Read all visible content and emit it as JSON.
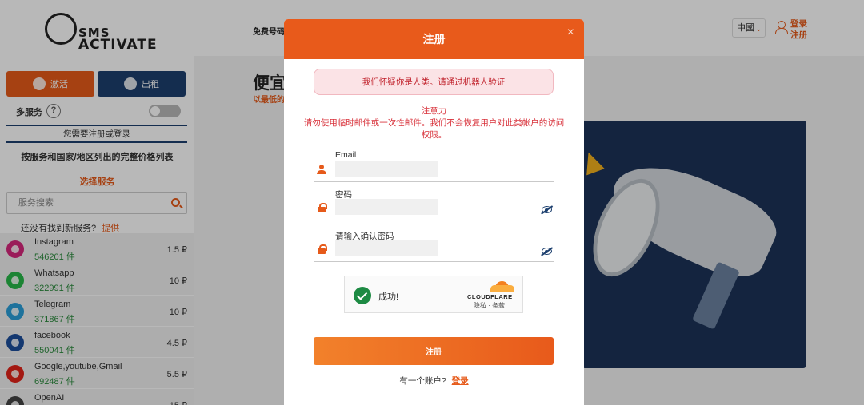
{
  "logo": {
    "line1": "SMS",
    "line2": "ACTIVATE"
  },
  "sidebar": {
    "activate_label": "激活",
    "rent_label": "出租",
    "multi_service_label": "多服务",
    "help_label": "?",
    "need_login_text": "您需要注册或登录",
    "price_list_link": "按服务和国家/地区列出的完整价格列表",
    "select_service_label": "选择服务",
    "search_placeholder": "服务搜索",
    "not_found_text": "还没有找到新服务?",
    "offer_link": "提供",
    "services": [
      {
        "name": "Instagram",
        "count": "546201 件",
        "price": "1.5 ₽",
        "icon": "instagram-icon",
        "color": "#d6287c"
      },
      {
        "name": "Whatsapp",
        "count": "322991 件",
        "price": "10 ₽",
        "icon": "whatsapp-icon",
        "color": "#27b848"
      },
      {
        "name": "Telegram",
        "count": "371867 件",
        "price": "10 ₽",
        "icon": "telegram-icon",
        "color": "#2a9ed8"
      },
      {
        "name": "facebook",
        "count": "550041 件",
        "price": "4.5 ₽",
        "icon": "facebook-icon",
        "color": "#1d4e9c"
      },
      {
        "name": "Google,youtube,Gmail",
        "count": "692487 件",
        "price": "5.5 ₽",
        "icon": "youtube-icon",
        "color": "#e2231a"
      },
      {
        "name": "OpenAI",
        "count": "",
        "price": "15 ₽",
        "icon": "openai-icon",
        "color": "#444444"
      }
    ]
  },
  "topbar": {
    "free_numbers_link": "免费号码",
    "language": "中國",
    "login_label": "登录",
    "register_label": "注册"
  },
  "hero": {
    "title": "便宜",
    "subtitle": "以最低的"
  },
  "modal": {
    "title": "注册",
    "close_label": "×",
    "robot_alert": "我们怀疑你是人类。请通过机器人验证",
    "attention_title": "注意力",
    "attention_body": "请勿使用临时邮件或一次性邮件。我们不会恢复用户对此类帐户的访问权限。",
    "email_label": "Email",
    "email_value": "",
    "password_label": "密码",
    "password_value": "",
    "confirm_password_label": "请输入确认密码",
    "confirm_password_value": "",
    "captcha_success": "成功!",
    "captcha_brand": "CLOUDFLARE",
    "captcha_links": "隐私 · 条款",
    "submit_label": "注册",
    "have_account_text": "有一个账户?",
    "login_link": "登录"
  },
  "colors": {
    "accent": "#e85a1b",
    "navy": "#1c3f6e",
    "alert_text": "#c0202a",
    "success_green": "#1d8a43"
  }
}
